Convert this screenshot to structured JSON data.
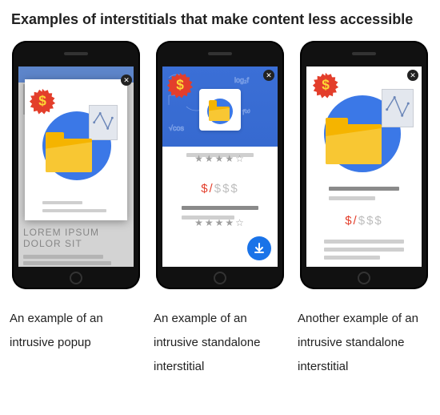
{
  "title": "Examples of interstitials that make content less accessible",
  "badge_symbol": "$",
  "price": {
    "discount": "$/",
    "full": "$$$"
  },
  "lorem": "LOREM IPSUM dolor sit",
  "phones": [
    {
      "caption": "An example of an intrusive popup"
    },
    {
      "caption": "An example of an intrusive standalone interstitial"
    },
    {
      "caption": "Another example of an intrusive standalone interstitial"
    }
  ],
  "stars": "★★★★☆",
  "colors": {
    "blue": "#3b78e7",
    "yellow": "#f5b400",
    "red": "#e33e2b",
    "grey": "#cfcfcf"
  }
}
